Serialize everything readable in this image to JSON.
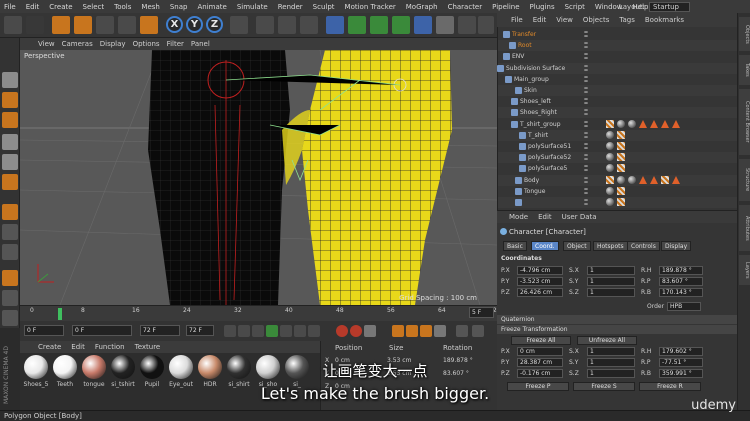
{
  "menubar": {
    "items": [
      "File",
      "Edit",
      "Create",
      "Select",
      "Tools",
      "Mesh",
      "Snap",
      "Animate",
      "Simulate",
      "Render",
      "Sculpt",
      "Motion Tracker",
      "MoGraph",
      "Character",
      "Pipeline",
      "Plugins",
      "Script",
      "Window",
      "Help"
    ],
    "layout_label": "Layout:",
    "layout_value": "Startup"
  },
  "toolbar": {
    "axis_x": "X",
    "axis_y": "Y",
    "axis_z": "Z"
  },
  "viewport": {
    "menu": [
      "View",
      "Cameras",
      "Display",
      "Options",
      "Filter",
      "Panel"
    ],
    "label": "Perspective",
    "grid_spacing": "Grid Spacing : 100 cm"
  },
  "timeline": {
    "ticks": [
      "0",
      "8",
      "16",
      "24",
      "32",
      "40",
      "48",
      "56",
      "64",
      "72"
    ],
    "end_field": "5 F",
    "start_field": "0 F",
    "min_field": "0 F",
    "max_field": "72 F",
    "max_field2": "72 F"
  },
  "materials": {
    "menu": [
      "Create",
      "Edit",
      "Function",
      "Texture"
    ],
    "items": [
      {
        "label": "Shoes_5",
        "color": "#e8e8e8"
      },
      {
        "label": "Teeth",
        "color": "#f4f4f4"
      },
      {
        "label": "tongue",
        "color": "#c87a6a"
      },
      {
        "label": "si_tshirt",
        "color": "#222222"
      },
      {
        "label": "Pupil",
        "color": "#111111"
      },
      {
        "label": "Eye_out",
        "color": "#dcdcdc"
      },
      {
        "label": "HDR",
        "color": "#c88a6a"
      },
      {
        "label": "si_shirt",
        "color": "#303030"
      },
      {
        "label": "si_sho",
        "color": "#d0d0d0"
      },
      {
        "label": "si_",
        "color": "#555555"
      }
    ]
  },
  "coords": {
    "headers": [
      "Position",
      "Size",
      "Rotation"
    ],
    "rows": [
      {
        "axis": "X",
        "pos": "0 cm",
        "size": "3.53 cm",
        "rot": "189.878 °"
      },
      {
        "axis": "Y",
        "pos": "0 cm",
        "size": "3.53 cm",
        "rot": "83.607 °"
      },
      {
        "axis": "Z",
        "pos": "0 cm",
        "size": "20 cm",
        "rot": "170.143 °"
      }
    ]
  },
  "statusbar": {
    "text": "Polygon Object [Body]"
  },
  "objects_panel": {
    "menu": [
      "File",
      "Edit",
      "View",
      "Objects",
      "Tags",
      "Bookmarks"
    ],
    "rows": [
      {
        "name": "Transfer",
        "indent": 14,
        "orange": true,
        "tags": []
      },
      {
        "name": "Root",
        "indent": 20,
        "orange": true,
        "tags": []
      },
      {
        "name": "ENV",
        "indent": 14,
        "orange": false,
        "tags": []
      },
      {
        "name": "Subdivision Surface",
        "indent": 8,
        "orange": false,
        "tags": []
      },
      {
        "name": "Main_group",
        "indent": 16,
        "orange": false,
        "tags": []
      },
      {
        "name": "Skin",
        "indent": 26,
        "orange": false,
        "tags": []
      },
      {
        "name": "Shoes_left",
        "indent": 22,
        "orange": false,
        "tags": []
      },
      {
        "name": "Shoes_Right",
        "indent": 22,
        "orange": false,
        "tags": []
      },
      {
        "name": "T_shirt_group",
        "indent": 22,
        "orange": false,
        "tags": [
          "sq",
          "ball",
          "ball",
          "tri",
          "tri",
          "tri",
          "tri"
        ]
      },
      {
        "name": "T_shirt",
        "indent": 30,
        "orange": false,
        "tags": [
          "ball",
          "sq"
        ]
      },
      {
        "name": "polySurface51",
        "indent": 30,
        "orange": false,
        "tags": [
          "ball",
          "sq"
        ]
      },
      {
        "name": "polySurface52",
        "indent": 30,
        "orange": false,
        "tags": [
          "ball",
          "sq"
        ]
      },
      {
        "name": "polySurface5",
        "indent": 30,
        "orange": false,
        "tags": [
          "ball",
          "sq"
        ]
      },
      {
        "name": "Body",
        "indent": 26,
        "orange": false,
        "tags": [
          "sq",
          "ball",
          "ball",
          "tri",
          "tri",
          "sq",
          "tri"
        ]
      },
      {
        "name": "Tongue",
        "indent": 26,
        "orange": false,
        "tags": [
          "ball",
          "sq"
        ]
      },
      {
        "name": "",
        "indent": 26,
        "orange": false,
        "tags": [
          "ball",
          "sq"
        ]
      }
    ]
  },
  "attributes": {
    "menu": [
      "Mode",
      "Edit",
      "User Data"
    ],
    "title": "Character [Character]",
    "tabs": [
      "Basic",
      "Coord.",
      "Object",
      "Hotspots",
      "Controls",
      "Display"
    ],
    "active_tab": 1,
    "coordinates_title": "Coordinates",
    "fields": [
      {
        "p": "-4.796 cm",
        "s": "1",
        "r": "189.878 °"
      },
      {
        "p": "-3.523 cm",
        "s": "1",
        "r": "83.607 °"
      },
      {
        "p": "26.426 cm",
        "s": "1",
        "r": "170.143 °"
      }
    ],
    "order_label": "Order",
    "order_value": "HPB",
    "quaternion": "Quaternion",
    "freeze": "Freeze Transformation",
    "freeze_all": "Freeze All",
    "unfreeze_all": "Unfreeze All",
    "frozen": [
      {
        "p": "0 cm",
        "s": "1",
        "r": "179.602 °"
      },
      {
        "p": "28.387 cm",
        "s": "1",
        "r": "-77.51 °"
      },
      {
        "p": "-0.176 cm",
        "s": "1",
        "r": "359.991 °"
      }
    ],
    "freeze_p": "Freeze P",
    "freeze_s": "Freeze S",
    "freeze_r": "Freeze R"
  },
  "rightstrip": [
    "Objects",
    "Takes",
    "Content Browser",
    "Structure",
    "Attributes",
    "Layers"
  ],
  "subtitles": {
    "cn": "让画笔变大一点",
    "en": "Let's make the brush bigger."
  },
  "watermark": "udemy",
  "brand": "MAXON CINEMA 4D"
}
